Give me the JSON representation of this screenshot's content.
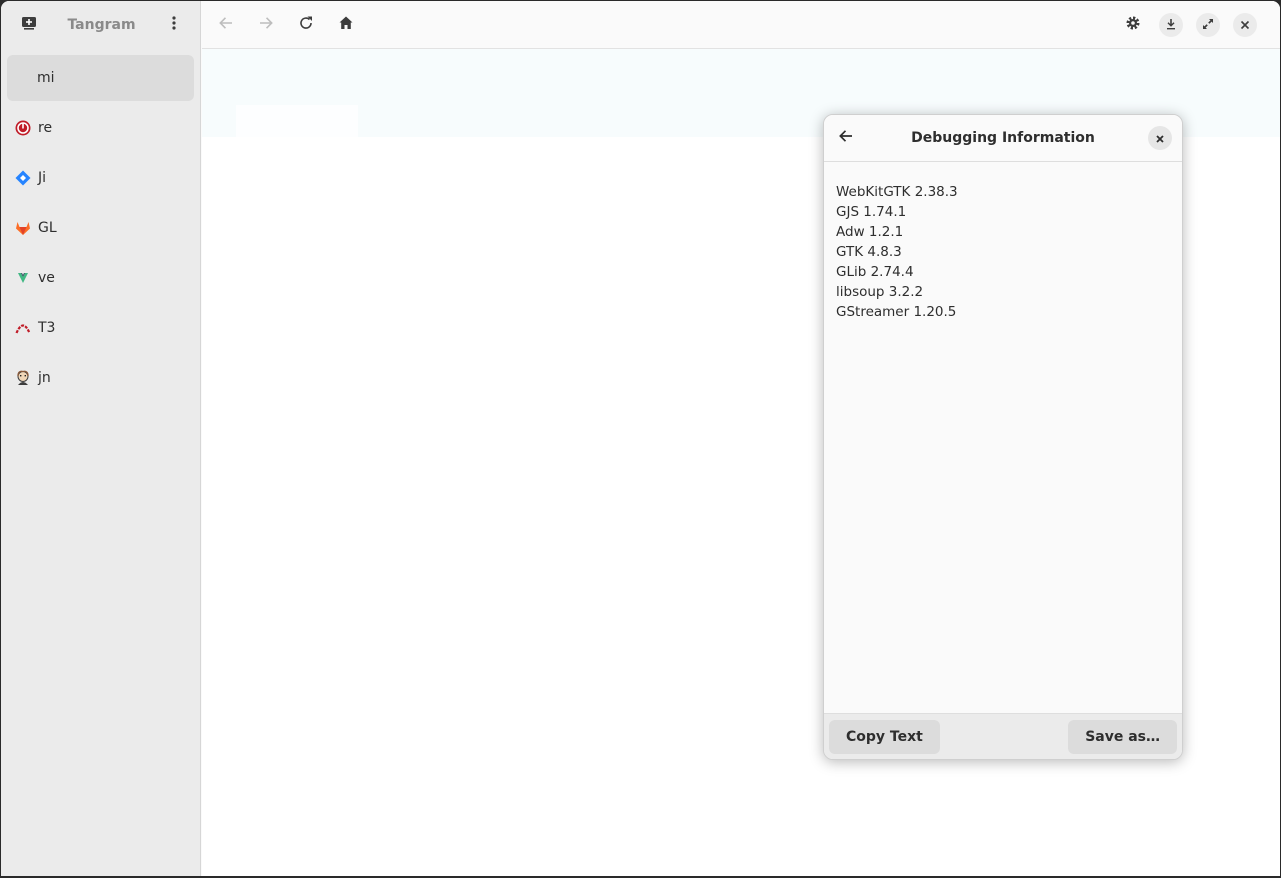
{
  "app": {
    "title": "Tangram"
  },
  "sidebar": {
    "items": [
      {
        "label": "mi",
        "icon": "none",
        "selected": true
      },
      {
        "label": "re",
        "icon": "power-red-icon"
      },
      {
        "label": "Ji",
        "icon": "jira-diamond-icon"
      },
      {
        "label": "GL",
        "icon": "gitlab-fox-icon"
      },
      {
        "label": "ve",
        "icon": "vue-v-icon"
      },
      {
        "label": "T3",
        "icon": "t3-arch-icon"
      },
      {
        "label": "jn",
        "icon": "jenkins-avatar-icon"
      }
    ]
  },
  "toolbar": {
    "icons": [
      "back-arrow-icon",
      "forward-arrow-icon",
      "reload-icon",
      "home-icon",
      "gear-icon",
      "download-icon",
      "fullscreen-icon",
      "close-icon"
    ]
  },
  "dialog": {
    "title": "Debugging Information",
    "lines": [
      "WebKitGTK 2.38.3",
      "GJS 1.74.1",
      "Adw 1.2.1",
      "GTK 4.8.3",
      "GLib 2.74.4",
      "libsoup 3.2.2",
      "GStreamer 1.20.5"
    ],
    "copy_label": "Copy Text",
    "save_label": "Save as…"
  },
  "colors": {
    "sidebar_bg": "#ebebeb",
    "selected_bg": "#dcdcdc",
    "web_band": "#f7fcfd",
    "accent_red": "#c01c28",
    "jira_blue": "#2684ff",
    "gitlab_orange": "#e24329"
  }
}
